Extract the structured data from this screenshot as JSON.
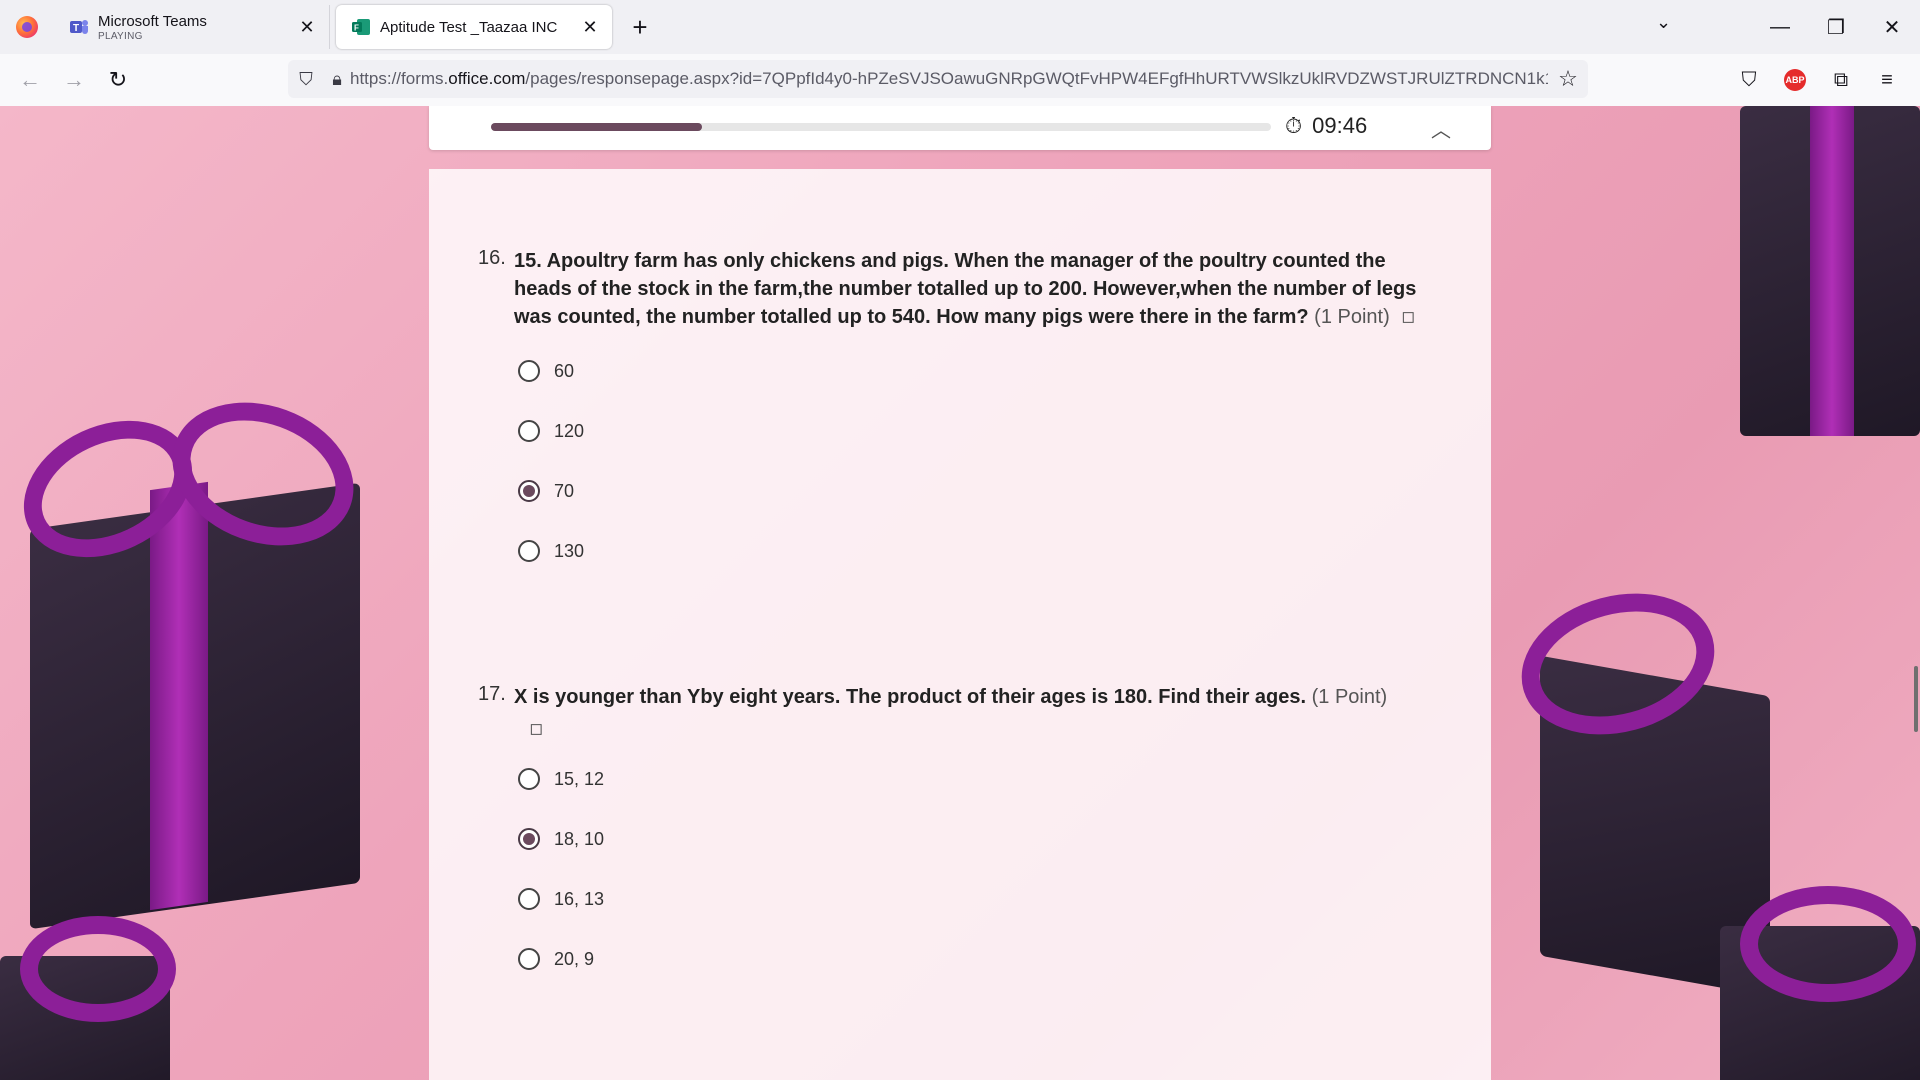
{
  "browser": {
    "tabs": [
      {
        "title": "Microsoft Teams",
        "subtitle": "PLAYING",
        "active": false
      },
      {
        "title": "Aptitude Test _Taazaa INC",
        "subtitle": "",
        "active": true
      }
    ],
    "url_prefix": "https://forms.",
    "url_domain": "office.com",
    "url_rest": "/pages/responsepage.aspx?id=7QPpfId4y0-hPZeSVJSOawuGNRpGWQtFvHPW4EFgfHhURTVWSlkzUklRVDZWSTJRUlZTRDNCN1k1V",
    "abp_label": "ABP"
  },
  "progress": {
    "fraction": 0.27,
    "timer": "09:46"
  },
  "questions": [
    {
      "number": "16.",
      "text": "15.  Apoultry farm has only chickens and pigs.  When the manager of the poultry counted the heads of the stock in the farm,the number totalled up to 200.   However,when the number of legs was counted, the number totalled up to 540.   How many pigs were there in the farm?",
      "points": "(1 Point)",
      "options": [
        "60",
        "120",
        "70",
        "130"
      ],
      "selected_index": 2
    },
    {
      "number": "17.",
      "text": "X is younger than Yby eight years. The product of their ages is 180. Find their ages.",
      "points": "(1 Point)",
      "options": [
        "15, 12",
        "18, 10",
        "16, 13",
        "20, 9"
      ],
      "selected_index": 1
    }
  ],
  "colors": {
    "accent": "#6b4a5e",
    "background_pink": "#eea4bb",
    "ribbon_purple": "#8c1f98"
  }
}
